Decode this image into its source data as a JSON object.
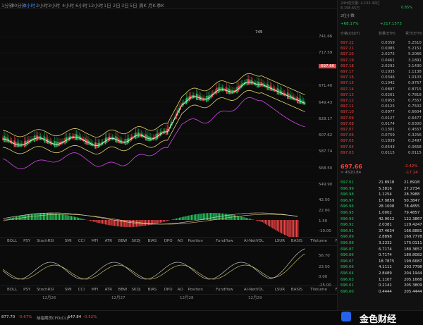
{
  "toolbar": {
    "timeframes": [
      "1分钟",
      "30分钟",
      "1小时",
      "2小时",
      "3小时",
      "4小时",
      "6小时",
      "12小时",
      "1日",
      "2日",
      "3日",
      "5日",
      "周K",
      "月K",
      "季K"
    ],
    "active_index": 2
  },
  "y_axis": [
    "741.66",
    "717.59",
    "697.66",
    "671.40",
    "649.43",
    "628.17",
    "607.62",
    "587.74",
    "568.50",
    "549.90"
  ],
  "current_price_tag": "697.66",
  "x_axis": [
    "12月26",
    "12月27",
    "12月28",
    "12月29"
  ],
  "indicators": [
    "BOLL",
    "PSY",
    "StochRSI",
    "SMI",
    "CCI",
    "MFI",
    "ATR",
    "BBW",
    "SKDJ",
    "BIAS",
    "DPO",
    "AO",
    "Position",
    "Fundflow",
    "AI-NetVOL",
    "LSUR",
    "BASIS",
    "TVolume",
    "FTBS",
    "TTSI",
    "TTMU",
    "AI-BSI",
    "MLR"
  ],
  "macd_axis": [
    "42.50",
    "22.00",
    "1.50",
    "-10.00"
  ],
  "kdj_axis": [
    "56.70",
    "23.50",
    "0.00",
    "-25.00"
  ],
  "kline_peak": "745",
  "panel": {
    "top_label": "24H成交量: 4.165.40亿",
    "top_value": "8,158.65万",
    "top_change": "0.85%",
    "interval": "2位小数",
    "buy_ratio": "+68.17%",
    "sell_ratio": "+217.1573",
    "headers": [
      "价格(USDT)",
      "数量(ETH)",
      "累计(ETH)"
    ],
    "asks": [
      [
        "697.22",
        "0.0359",
        "5.2510"
      ],
      [
        "697.21",
        "0.0085",
        "5.2151"
      ],
      [
        "697.20",
        "2.0275",
        "5.2066"
      ],
      [
        "697.19",
        "0.0461",
        "3.1891"
      ],
      [
        "697.18",
        "2.0292",
        "3.1430"
      ],
      [
        "697.17",
        "0.1035",
        "1.1138"
      ],
      [
        "697.16",
        "0.0346",
        "1.0103"
      ],
      [
        "697.15",
        "0.1042",
        "0.9757"
      ],
      [
        "697.14",
        "0.0897",
        "0.8715"
      ],
      [
        "697.13",
        "0.0261",
        "0.7818"
      ],
      [
        "697.12",
        "0.0953",
        "0.7557"
      ],
      [
        "697.11",
        "0.0125",
        "0.7502"
      ],
      [
        "697.10",
        "0.0977",
        "0.6604"
      ],
      [
        "697.09",
        "0.0127",
        "0.6477"
      ],
      [
        "697.08",
        "0.0174",
        "0.6300"
      ],
      [
        "697.07",
        "0.1301",
        "0.4557"
      ],
      [
        "697.06",
        "0.0759",
        "0.3256"
      ],
      [
        "697.05",
        "0.1839",
        "0.2497"
      ],
      [
        "697.04",
        "0.0543",
        "0.0658"
      ],
      [
        "697.03",
        "0.0115",
        "0.0115"
      ]
    ],
    "last_price": "697.66",
    "last_change": "-2.42%",
    "last_cny": "≈ 4520.84",
    "last_diff": "-17.24",
    "bids": [
      [
        "697.01",
        "21.8918",
        "21.8918"
      ],
      [
        "696.99",
        "5.3816",
        "27.2734"
      ],
      [
        "696.98",
        "1.1254",
        "28.3988"
      ],
      [
        "696.97",
        "17.9859",
        "50.3847"
      ],
      [
        "696.96",
        "28.1008",
        "78.4855"
      ],
      [
        "696.95",
        "1.0002",
        "79.4857"
      ],
      [
        "696.93",
        "42.9012",
        "122.3867"
      ],
      [
        "696.92",
        "2.0381",
        "129.4247"
      ],
      [
        "696.91",
        "37.4634",
        "166.8881"
      ],
      [
        "696.89",
        "2.8898",
        "169.7778"
      ],
      [
        "696.88",
        "3.2332",
        "175.0111"
      ],
      [
        "696.87",
        "6.7174",
        "180.3657"
      ],
      [
        "696.86",
        "0.7174",
        "180.8082"
      ],
      [
        "696.67",
        "18.7875",
        "199.6687"
      ],
      [
        "696.66",
        "4.1111",
        "203.7798"
      ],
      [
        "696.64",
        "2.8489",
        "204.1944"
      ],
      [
        "696.63",
        "1.1107",
        "205.1668"
      ],
      [
        "696.61",
        "0.2141",
        "205.3809"
      ],
      [
        "696.60",
        "0.4444",
        "205.4444"
      ]
    ]
  },
  "bottom": {
    "left_price": "877.70",
    "left_change": "-0.67%",
    "pair2": "纳指期货CFD(CL):",
    "pair2_price": "$47.84",
    "pair2_change": "-0.52%",
    "watermark": "金色财经"
  },
  "colors": {
    "up": "#22c55e",
    "down": "#ef4444",
    "accent": "#3b82f6"
  }
}
